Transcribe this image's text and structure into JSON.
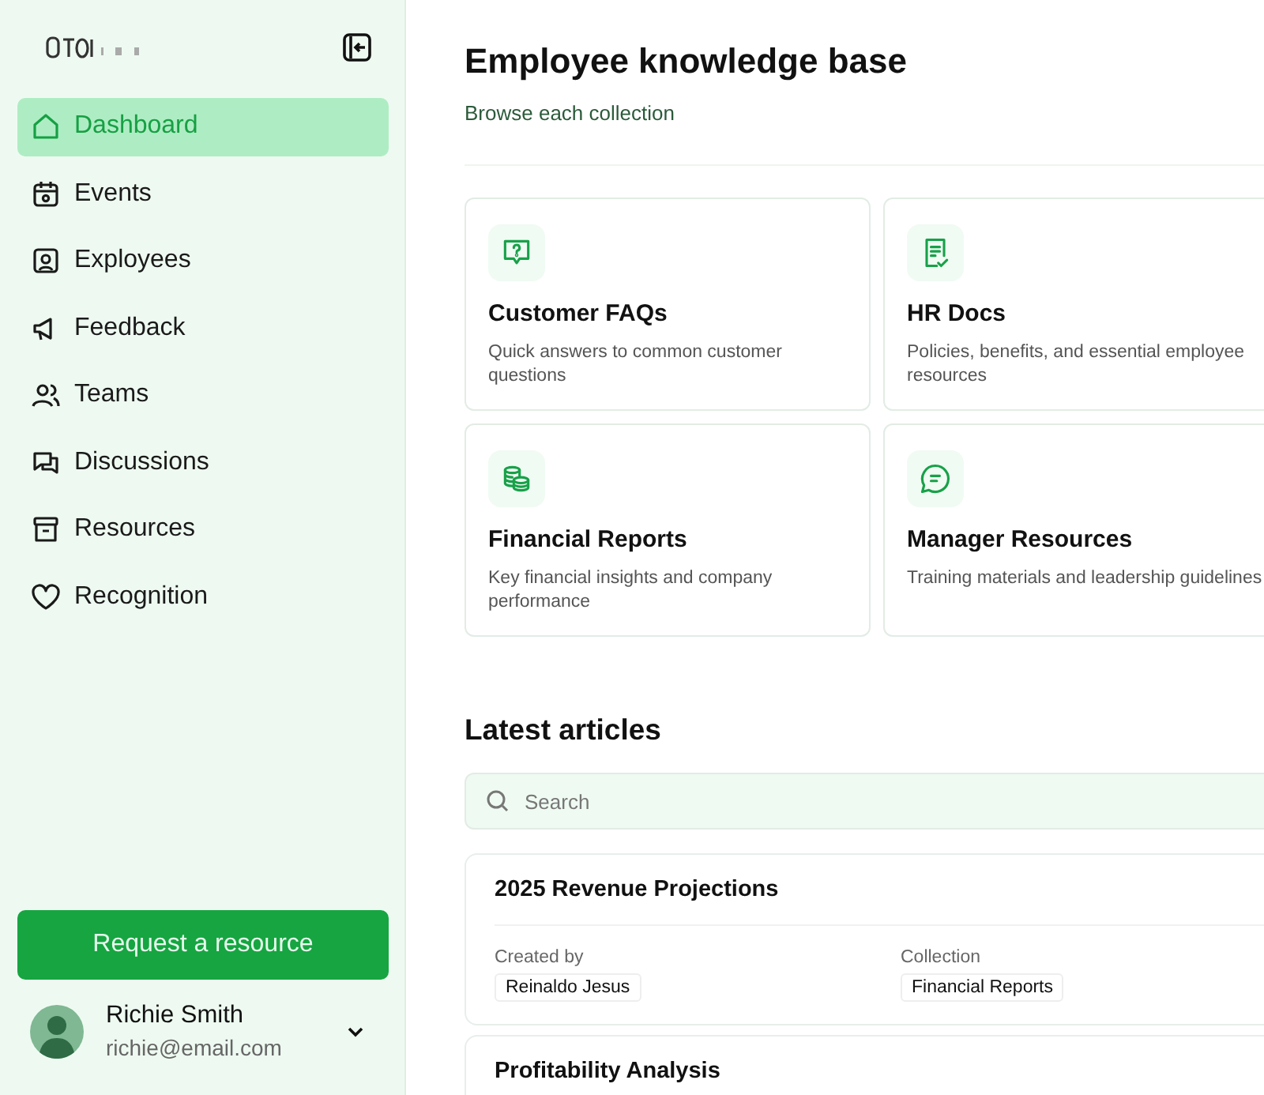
{
  "sidebar": {
    "nav": [
      {
        "label": "Dashboard",
        "kind": "home",
        "selected": true
      },
      {
        "label": "Events",
        "kind": "calendar",
        "selected": false
      },
      {
        "label": "Exployees",
        "kind": "person",
        "selected": false
      },
      {
        "label": "Feedback",
        "kind": "megaphone",
        "selected": false
      },
      {
        "label": "Teams",
        "kind": "people",
        "selected": false
      },
      {
        "label": "Discussions",
        "kind": "chats",
        "selected": false
      },
      {
        "label": "Resources",
        "kind": "archive",
        "selected": false
      },
      {
        "label": "Recognition",
        "kind": "heart",
        "selected": false
      }
    ],
    "request_button": "Request a resource",
    "user": {
      "name": "Richie Smith",
      "email": "richie@email.com"
    }
  },
  "header": {
    "title": "Employee knowledge base",
    "subtitle": "Browse each collection"
  },
  "collections": [
    {
      "kind": "question",
      "title": "Customer FAQs",
      "description": "Quick answers to common customer questions"
    },
    {
      "kind": "document",
      "title": "HR Docs",
      "description": "Policies, benefits, and essential employee resources"
    },
    {
      "kind": "coins",
      "title": "Financial Reports",
      "description": "Key financial insights and company performance"
    },
    {
      "kind": "chat",
      "title": "Manager Resources",
      "description": "Training materials and leadership guidelines"
    }
  ],
  "articles": {
    "title": "Latest articles",
    "search": {
      "placeholder": "Search"
    },
    "items": [
      {
        "title": "2025 Revenue Projections",
        "created_by_label": "Created by",
        "created_by": "Reinaldo Jesus",
        "collection_label": "Collection",
        "collection": "Financial Reports"
      },
      {
        "title": "Profitability Analysis"
      }
    ]
  }
}
